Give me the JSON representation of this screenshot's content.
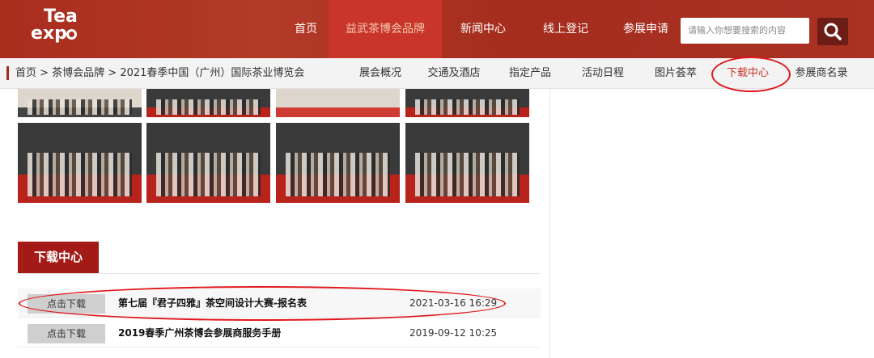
{
  "header": {
    "logo": {
      "line1": "Tea",
      "line2": "exp"
    },
    "nav": [
      "首页",
      "益武茶博会品牌",
      "新闻中心",
      "线上登记",
      "参展申请"
    ],
    "active_nav": "益武茶博会品牌",
    "search_placeholder": "请输入你想要搜索的内容",
    "search_icon": "search-icon",
    "accent_color": "#a52a1e"
  },
  "subbar": {
    "breadcrumb": "首页 > 茶博会品牌 > 2021春季中国（广州）国际茶业博览会",
    "items": [
      "展会概况",
      "交通及酒店",
      "指定产品",
      "活动日程",
      "图片荟萃",
      "下载中心",
      "参展商名录"
    ],
    "active": "下载中心"
  },
  "download": {
    "title": "下载中心",
    "rows": [
      {
        "button": "点击下载",
        "name": "第七届『君子四雅』茶空间设计大赛-报名表",
        "date": "2021-03-16 16:29"
      },
      {
        "button": "点击下载",
        "name": "2019春季广州茶博会参展商服务手册",
        "date": "2019-09-12 10:25"
      }
    ]
  }
}
